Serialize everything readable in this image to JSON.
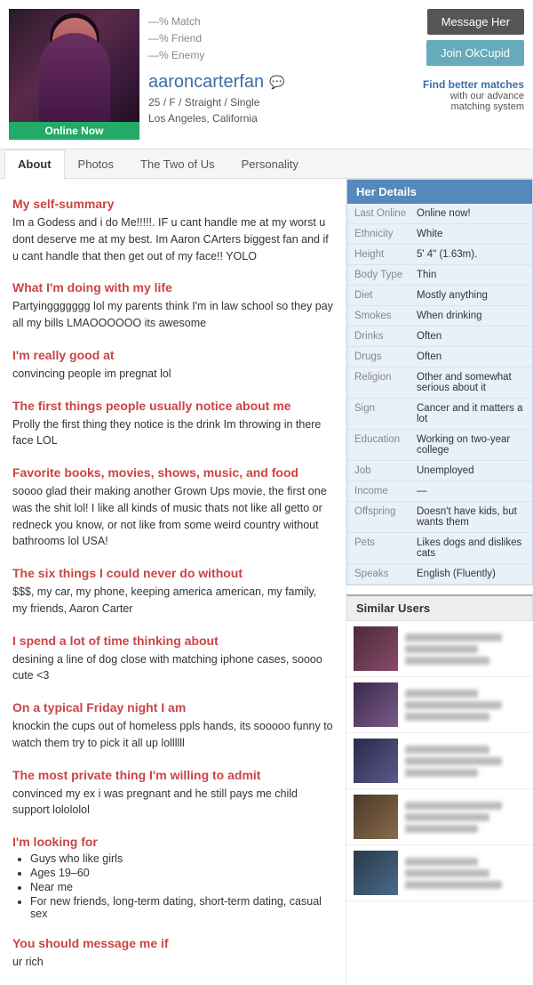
{
  "header": {
    "online_badge": "Online Now",
    "match_label": "—% Match",
    "friend_label": "—% Friend",
    "enemy_label": "—% Enemy",
    "username": "aaroncarterfan",
    "age": "25",
    "gender": "F",
    "orientation": "Straight",
    "status": "Single",
    "location": "Los Angeles, California",
    "btn_message": "Message Her",
    "btn_join": "Join OkCupid",
    "find_title": "Find better",
    "find_sub1": "matches",
    "find_sub2": "with our advance",
    "find_sub3": "matching system"
  },
  "tabs": {
    "about": "About",
    "photos": "Photos",
    "two_of_us": "The Two of Us",
    "personality": "Personality"
  },
  "sections": {
    "summary_heading": "My self-summary",
    "summary_body": "Im a Godess and i do Me!!!!!. IF u cant handle me at my worst u dont deserve me at my best. Im Aaron CArters biggest fan and if u cant handle that then get out of my face!! YOLO",
    "doing_heading": "What I'm doing with my life",
    "doing_body": "Partyinggggggg lol my parents think I'm in law school so they pay all my bills LMAOOOOOO its awesome",
    "good_at_heading": "I'm really good at",
    "good_at_body": "convincing people im pregnat lol",
    "notice_heading": "The first things people usually notice about me",
    "notice_body": "Prolly the first thing they notice is the drink Im throwing in there face LOL",
    "books_heading": "Favorite books, movies, shows, music, and food",
    "books_body": "soooo glad their making another Grown Ups movie, the first one was the shit lol! I like all kinds of music thats not like all getto or redneck you know, or not like from some weird country without bathrooms lol USA!",
    "six_things_heading": "The six things I could never do without",
    "six_things_body": "$$$, my car, my phone, keeping america american, my family, my friends, Aaron Carter",
    "thinking_heading": "I spend a lot of time thinking about",
    "thinking_body": "desining a line of dog close with matching iphone cases, soooo cute <3",
    "friday_heading": "On a typical Friday night I am",
    "friday_body": "knockin the cups out of homeless ppls hands, its sooooo funny to watch them try to pick it all up lollllll",
    "private_heading": "The most private thing I'm willing to admit",
    "private_body": "convinced my ex i was pregnant and he still pays me child support lolololol",
    "looking_heading": "I'm looking for",
    "looking_list": [
      "Guys who like girls",
      "Ages 19–60",
      "Near me",
      "For new friends, long-term dating, short-term dating, casual sex"
    ],
    "message_heading": "You should message me if",
    "message_body": "ur rich"
  },
  "her_details": {
    "header": "Her Details",
    "rows": [
      {
        "label": "Last Online",
        "value": "Online now!"
      },
      {
        "label": "Ethnicity",
        "value": "White"
      },
      {
        "label": "Height",
        "value": "5' 4\" (1.63m)."
      },
      {
        "label": "Body Type",
        "value": "Thin"
      },
      {
        "label": "Diet",
        "value": "Mostly anything"
      },
      {
        "label": "Smokes",
        "value": "When drinking"
      },
      {
        "label": "Drinks",
        "value": "Often"
      },
      {
        "label": "Drugs",
        "value": "Often"
      },
      {
        "label": "Religion",
        "value": "Other and somewhat serious about it"
      },
      {
        "label": "Sign",
        "value": "Cancer and it matters a lot"
      },
      {
        "label": "Education",
        "value": "Working on two-year college"
      },
      {
        "label": "Job",
        "value": "Unemployed"
      },
      {
        "label": "Income",
        "value": "—"
      },
      {
        "label": "Offspring",
        "value": "Doesn't have kids, but wants them"
      },
      {
        "label": "Pets",
        "value": "Likes dogs and dislikes cats"
      },
      {
        "label": "Speaks",
        "value": "English (Fluently)"
      }
    ]
  },
  "similar_users": {
    "header": "Similar Users"
  }
}
